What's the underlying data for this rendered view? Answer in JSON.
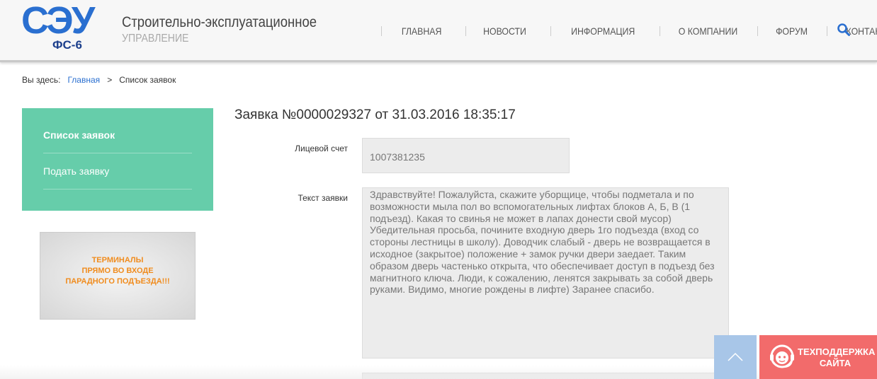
{
  "header": {
    "logo_text": "СЭУ",
    "logo_sub": "ФС-6",
    "site_title": "Строительно-эксплуатационное",
    "site_subtitle": "управление",
    "nav": [
      {
        "label": "Главная"
      },
      {
        "label": "Новости"
      },
      {
        "label": "Информация"
      },
      {
        "label": "О компании"
      },
      {
        "label": "Форум"
      },
      {
        "label": "Контакты"
      }
    ],
    "search_icon": "search-icon"
  },
  "breadcrumb": {
    "prefix": "Вы здесь:",
    "home": "Главная",
    "separator": ">",
    "current": "Список заявок"
  },
  "sidebar": {
    "items": [
      {
        "label": "Список заявок",
        "active": true
      },
      {
        "label": "Подать заявку",
        "active": false
      }
    ],
    "menu_color": "#66cdaa",
    "banner_text": [
      "ТЕРМИНАЛЫ",
      "ПРЯМО ВО ВХОДЕ",
      "ПАРАДНОГО ПОДЪЕЗДА!!!"
    ]
  },
  "main": {
    "title": "Заявка №0000029327 от 31.03.2016 18:35:17",
    "account_label": "Лицевой счет",
    "account_value": "1007381235",
    "text_label": "Текст заявки",
    "text_lines": [
      "Здравствуйте! Пожалуйста, скажите уборщице, чтобы подметала и по",
      "возможности мыла пол во вспомогательных лифтах блоков А, Б, В (1",
      "подъезд). Какая то свинья не может в лапах донести свой мусор)",
      "Убедительная просьба, почините входную дверь 1го подъезда (вход со",
      "стороны лестницы в школу). Доводчик слабый - дверь не возвращается в",
      "исходное (закрытое) положение + замок ручки двери заедает. Таким",
      "образом дверь частенько открыта, что обеспечивает доступ в подъезд без",
      "магнитного ключа. Люди, к сожалению, ленятся закрывать за собой дверь",
      "руками. Видимо, многие рождены в лифте) Заранее спасибо."
    ]
  },
  "widgets": {
    "scroll_top_icon": "chevron-up-icon",
    "support_icon": "support-agent-icon",
    "support_line1": "Техподдержка",
    "support_line2": "сайта",
    "support_color": "#f26b6b"
  }
}
